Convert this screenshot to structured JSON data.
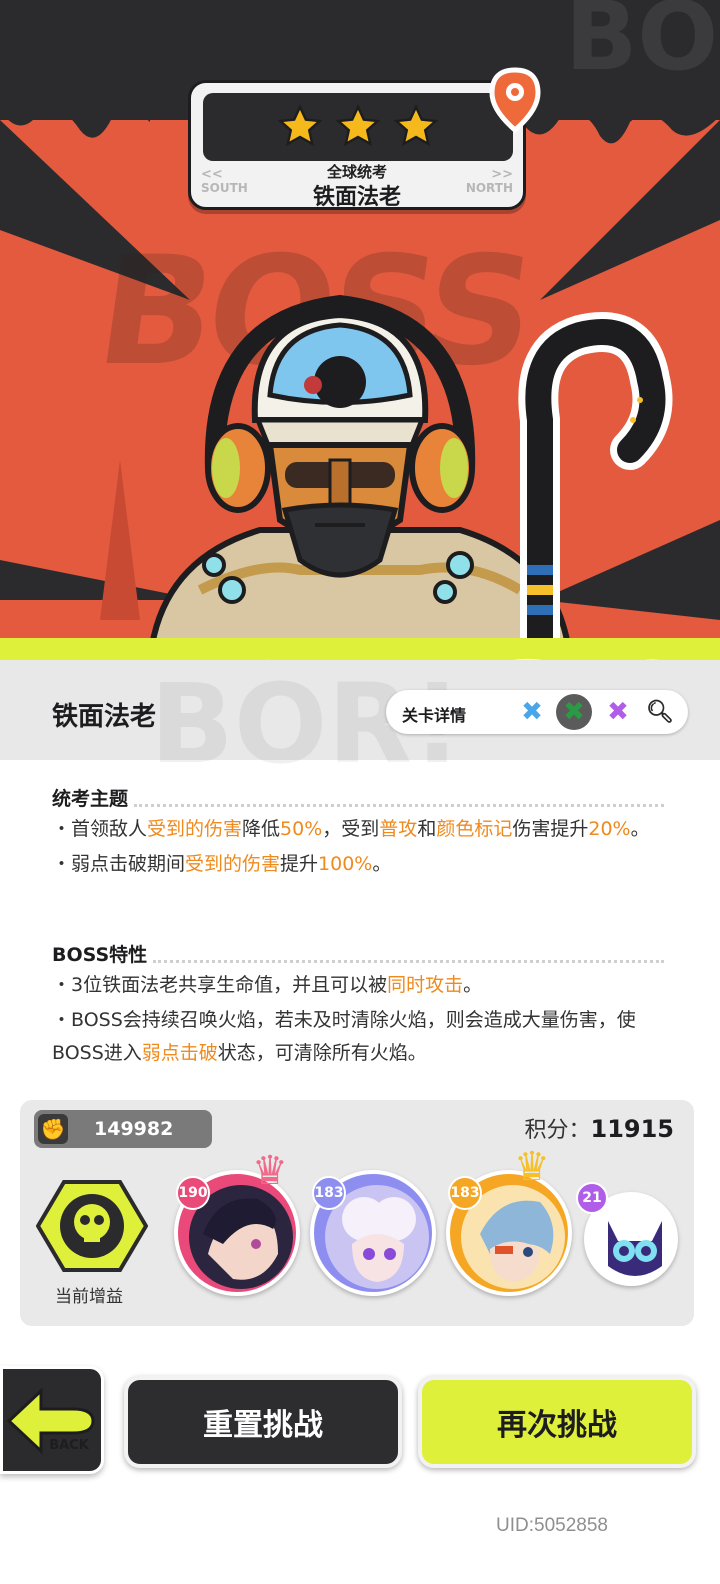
{
  "stage": {
    "subtitle": "全球统考",
    "name": "铁面法老",
    "left_dir": "SOUTH",
    "right_dir": "NORTH",
    "stars": 3,
    "star_color": "#f5b91b"
  },
  "hero_watermark": "BOSS",
  "hero_watermark_top": "BO",
  "panel": {
    "boss_name": "铁面法老",
    "detail_label": "关卡详情",
    "accent_color": "#dff03a"
  },
  "theme_section": {
    "title": "统考主题",
    "line1": [
      {
        "t": "・首领敌人",
        "hl": false
      },
      {
        "t": "受到的伤害",
        "hl": true
      },
      {
        "t": "降低",
        "hl": false
      },
      {
        "t": "50%",
        "hl": true
      },
      {
        "t": "，受到",
        "hl": false
      },
      {
        "t": "普攻",
        "hl": true
      },
      {
        "t": "和",
        "hl": false
      },
      {
        "t": "颜色标记",
        "hl": true
      },
      {
        "t": "伤害提升",
        "hl": false
      },
      {
        "t": "20%",
        "hl": true
      },
      {
        "t": "。",
        "hl": false
      }
    ],
    "line2": [
      {
        "t": "・弱点击破期间",
        "hl": false
      },
      {
        "t": "受到的伤害",
        "hl": true
      },
      {
        "t": "提升",
        "hl": false
      },
      {
        "t": "100%",
        "hl": true
      },
      {
        "t": "。",
        "hl": false
      }
    ]
  },
  "boss_section": {
    "title": "BOSS特性",
    "line1": [
      {
        "t": "・3位铁面法老共享生命值，并且可以被",
        "hl": false
      },
      {
        "t": "同时攻击",
        "hl": true
      },
      {
        "t": "。",
        "hl": false
      }
    ],
    "line2": [
      {
        "t": "・BOSS会持续召唤火焰，若未及时清除火焰，则会造成大量伤害，使BOSS进入",
        "hl": false
      },
      {
        "t": "弱点击破",
        "hl": true
      },
      {
        "t": "状态，可清除所有火焰。",
        "hl": false
      }
    ]
  },
  "team": {
    "power": "149982",
    "score_label": "积分：",
    "score_value": "11915",
    "buff_label": "当前增益",
    "members": [
      {
        "level": "190",
        "ring": "#e94a7a",
        "crown": true,
        "crown_color": "#f06a8a"
      },
      {
        "level": "183",
        "ring": "#8d8ef0",
        "crown": false
      },
      {
        "level": "183",
        "ring": "#f5a623",
        "crown": true,
        "crown_color": "#f5c02a"
      },
      {
        "level": "21",
        "ring": "#b05ee8",
        "crown": false
      }
    ]
  },
  "buttons": {
    "back": "BACK",
    "reset": "重置挑战",
    "retry": "再次挑战"
  },
  "uid": "UID:5052858"
}
